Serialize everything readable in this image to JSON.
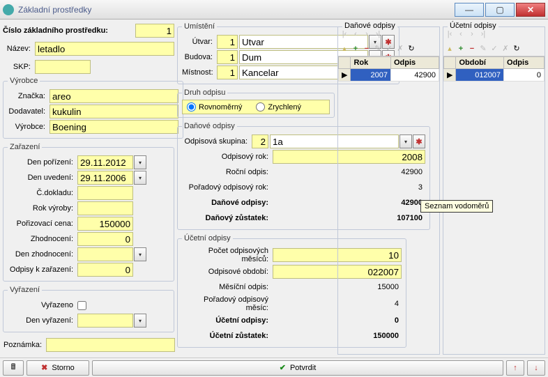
{
  "window": {
    "title": "Základní prostředky"
  },
  "id_block": {
    "id_label": "Číslo základního prostředku:",
    "id_value": "1"
  },
  "basic": {
    "nazev_label": "Název:",
    "nazev": "letadlo",
    "skp_label": "SKP:",
    "skp": ""
  },
  "vyrobce_group": {
    "legend": "Výrobce",
    "znacka_label": "Značka:",
    "znacka": "areo",
    "dodavatel_label": "Dodavatel:",
    "dodavatel": "kukulin",
    "vyrobce_label": "Výrobce:",
    "vyrobce": "Boening"
  },
  "zarazeni": {
    "legend": "Zařazení",
    "den_porizeni_label": "Den pořízení:",
    "den_porizeni": "29.11.2012",
    "den_uvedeni_label": "Den uvedení:",
    "den_uvedeni": "29.11.2006",
    "c_dokladu_label": "Č.dokladu:",
    "c_dokladu": "",
    "rok_vyroby_label": "Rok výroby:",
    "rok_vyroby": "",
    "porizovaci_label": "Pořizovací cena:",
    "porizovaci": "150000",
    "zhodnoceni_label": "Zhodnocení:",
    "zhodnoceni": "0",
    "den_zhodnoceni_label": "Den zhodnocení:",
    "den_zhodnoceni": "",
    "odpisy_k_zarazeni_label": "Odpisy k zařazení:",
    "odpisy_k_zarazeni": "0"
  },
  "vyrazeni": {
    "legend": "Vyřazení",
    "vyrazeno_label": "Vyřazeno",
    "den_vyrazeni_label": "Den vyřazení:",
    "den_vyrazeni": ""
  },
  "poznamka_label": "Poznámka:",
  "poznamka": "",
  "umisteni": {
    "legend": "Umístění",
    "utvar_label": "Útvar:",
    "utvar_num": "1",
    "utvar_name": "Utvar",
    "budova_label": "Budova:",
    "budova_num": "1",
    "budova_name": "Dum",
    "mistnost_label": "Místnost:",
    "mistnost_num": "1",
    "mistnost_name": "Kancelar"
  },
  "druh_odpisu": {
    "legend": "Druh odpisu",
    "rovnomerny": "Rovnoměrný",
    "zrychleny": "Zrychlený"
  },
  "danove": {
    "legend": "Daňové odpisy",
    "skupina_label": "Odpisová skupina:",
    "skupina_num": "2",
    "skupina_name": "1a",
    "odpisovy_rok_label": "Odpisový rok:",
    "odpisovy_rok": "2008",
    "rocni_odpis_label": "Roční odpis:",
    "rocni_odpis": "42900",
    "poradovy_rok_label": "Pořadový odpisový rok:",
    "poradovy_rok": "3",
    "danove_odpisy_label": "Daňové odpisy:",
    "danove_odpisy": "42900",
    "danovy_zustatek_label": "Daňový zůstatek:",
    "danovy_zustatek": "107100"
  },
  "ucetni": {
    "legend": "Účetní odpisy",
    "pocet_mesicu_label": "Počet odpisových měsíců:",
    "pocet_mesicu": "10",
    "odpisove_obdobi_label": "Odpisové období:",
    "odpisove_obdobi": "022007",
    "mesicni_odpis_label": "Měsíční odpis:",
    "mesicni_odpis": "15000",
    "poradovy_mesic_label": "Pořadový odpisový měsíc:",
    "poradovy_mesic": "4",
    "ucetni_odpisy_label": "Účetní odpisy:",
    "ucetni_odpisy": "0",
    "ucetni_zustatek_label": "Účetní zůstatek:",
    "ucetni_zustatek": "150000"
  },
  "right": {
    "left_title": "Daňové odpisy",
    "right_title": "Účetní odpisy",
    "tbl1": {
      "col1": "Rok",
      "col2": "Odpis",
      "row1_c1": "2007",
      "row1_c2": "42900"
    },
    "tbl2": {
      "col1": "Období",
      "col2": "Odpis",
      "row1_c1": "012007",
      "row1_c2": "0"
    },
    "tooltip": "Seznam vodoměrů"
  },
  "bottom": {
    "storno": "Storno",
    "potvrdit": "Potvrdit"
  }
}
